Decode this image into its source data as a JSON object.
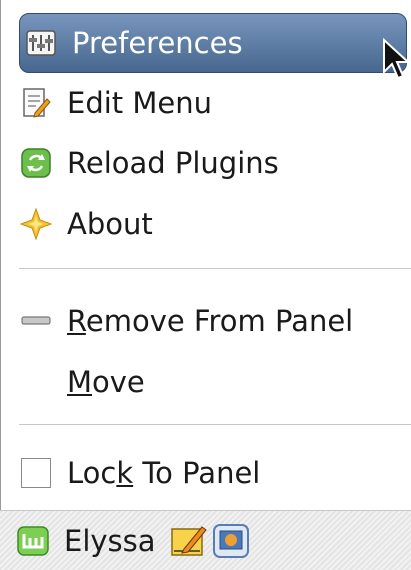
{
  "menu": {
    "items": [
      {
        "label": "Preferences",
        "icon": "preferences-icon"
      },
      {
        "label": "Edit Menu",
        "icon": "edit-menu-icon"
      },
      {
        "label": "Reload Plugins",
        "icon": "reload-icon"
      },
      {
        "label": "About",
        "icon": "about-star-icon"
      },
      {
        "label_pre": "",
        "label_u": "R",
        "label_post": "emove From Panel",
        "icon": "remove-icon"
      },
      {
        "label_pre": "",
        "label_u": "M",
        "label_post": "ove"
      },
      {
        "label_pre": "Loc",
        "label_u": "k",
        "label_post": " To Panel",
        "icon": "checkbox-icon",
        "checked": false
      }
    ]
  },
  "taskbar": {
    "menu_label": "Elyssa",
    "icons": [
      "mint-menu-icon",
      "text-editor-icon",
      "screenshot-icon"
    ]
  },
  "colors": {
    "highlight_top": "#7896bd",
    "highlight_bottom": "#47678f",
    "mint_green": "#5cb85c"
  }
}
